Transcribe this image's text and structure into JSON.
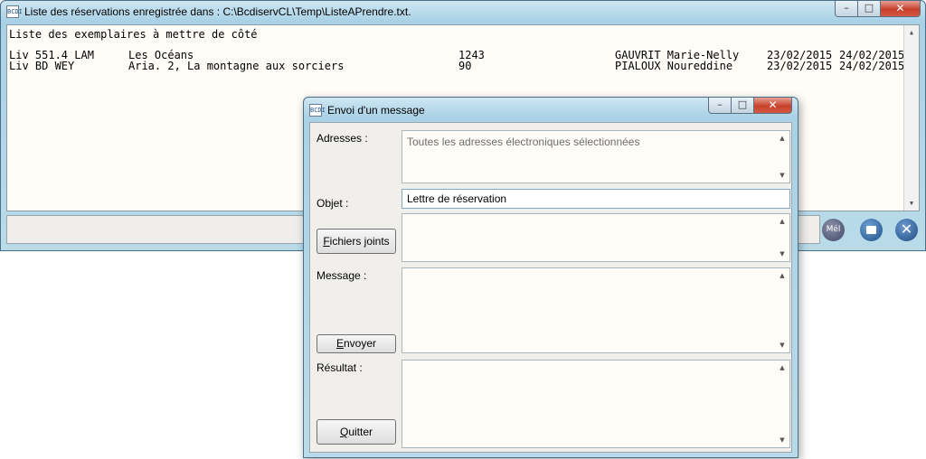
{
  "main_window": {
    "title": "Liste des réservations enregistrée dans : C:\\BcdiservCL\\Temp\\ListeAPrendre.txt.",
    "app_icon_text": "BCDI",
    "list_title": "Liste des exemplaires à mettre de côté",
    "rows": [
      {
        "cote": "Liv 551.4 LAM",
        "titre": "Les Océans",
        "numero": "1243",
        "emprunteur": "GAUVRIT Marie-Nelly",
        "debut": "23/02/2015",
        "fin": "24/02/2015"
      },
      {
        "cote": "Liv BD WEY",
        "titre": "Aria. 2, La montagne aux sorciers",
        "numero": "90",
        "emprunteur": "PIALOUX Noureddine",
        "debut": "23/02/2015",
        "fin": "24/02/2015"
      }
    ],
    "buttons": {
      "mel_label": "Mél",
      "print_icon": "printer-icon",
      "close_icon": "close-circle-icon"
    }
  },
  "dialog": {
    "title": "Envoi d'un message",
    "app_icon_text": "BCDI",
    "labels": {
      "adresses": "Adresses :",
      "objet": "Objet :",
      "message": "Message :",
      "resultat": "Résultat :"
    },
    "adresses_placeholder": "Toutes les adresses électroniques sélectionnées",
    "objet_value": "Lettre de réservation",
    "buttons": {
      "fichiers_first": "F",
      "fichiers_rest": "ichiers joints",
      "envoyer_first": "E",
      "envoyer_rest": "nvoyer",
      "quitter_first": "Q",
      "quitter_rest": "uitter"
    }
  },
  "window_controls": {
    "minimize": "–",
    "maximize": "□",
    "close": "✕"
  },
  "colors": {
    "titlebar": "#b9dbe9",
    "close_button": "#c7402b",
    "panel_bg": "#f0efec",
    "text_bg": "#fffdf8"
  }
}
